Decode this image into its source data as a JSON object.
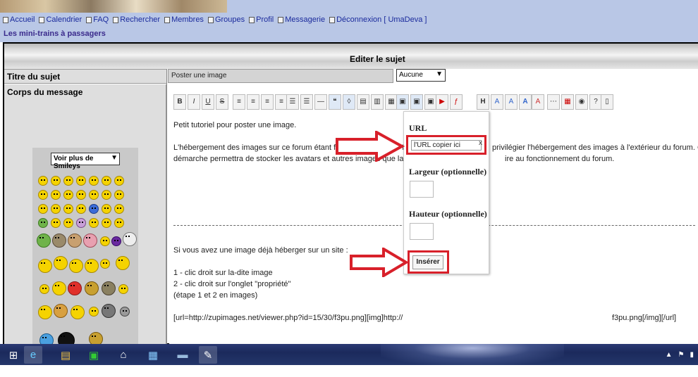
{
  "nav": {
    "items": [
      {
        "label": "Accueil"
      },
      {
        "label": "Calendrier"
      },
      {
        "label": "FAQ"
      },
      {
        "label": "Rechercher"
      },
      {
        "label": "Membres"
      },
      {
        "label": "Groupes"
      },
      {
        "label": "Profil"
      },
      {
        "label": "Messagerie"
      },
      {
        "label": "Déconnexion [ UmaDeva ]"
      }
    ]
  },
  "breadcrumb": {
    "forum": "Les mini-trains à passagers"
  },
  "form": {
    "heading": "Editer le sujet",
    "subject_label": "Titre du sujet",
    "subject_value": "Poster une image",
    "subject_type": "Aucune",
    "body_label": "Corps du message",
    "smileys_select": "Voir plus de Smileys"
  },
  "editor": {
    "lines": [
      "Petit tutoriel pour poster une image.",
      "L'hébergement des images sur ce forum étant fortement limité (20 Mo",
      "privilégier l'hébergement des images à l'extérieur du forum. Cet",
      "démarche permettra de stocker les avatars et autres images que la mod",
      "ire au fonctionnement du forum.",
      "Si vous avez une image déjà héberger sur un site :",
      "1 - clic droit sur la-dite image",
      "2 - clic droit sur l'onglet \"propriété\"",
      "(étape 1 et 2 en images)",
      "[url=http://zupimages.net/viewer.php?id=15/30/f3pu.png][img]http://",
      "f3pu.png[/img][/url]"
    ]
  },
  "popup": {
    "url_label": "URL",
    "url_value": "l'URL copier ici",
    "url_clear": "x",
    "width_label": "Largeur (optionnelle)",
    "height_label": "Hauteur (optionnelle)",
    "insert_label": "Insérer"
  },
  "toolbar": {
    "bold": "B",
    "italic": "I",
    "underline": "U",
    "strike": "S",
    "h": "H",
    "a1": "A",
    "a2": "A"
  },
  "colors": {
    "highlight_red": "#d8202a",
    "nav_link": "#1a2a9c",
    "page_bg": "#b9c7e6"
  }
}
